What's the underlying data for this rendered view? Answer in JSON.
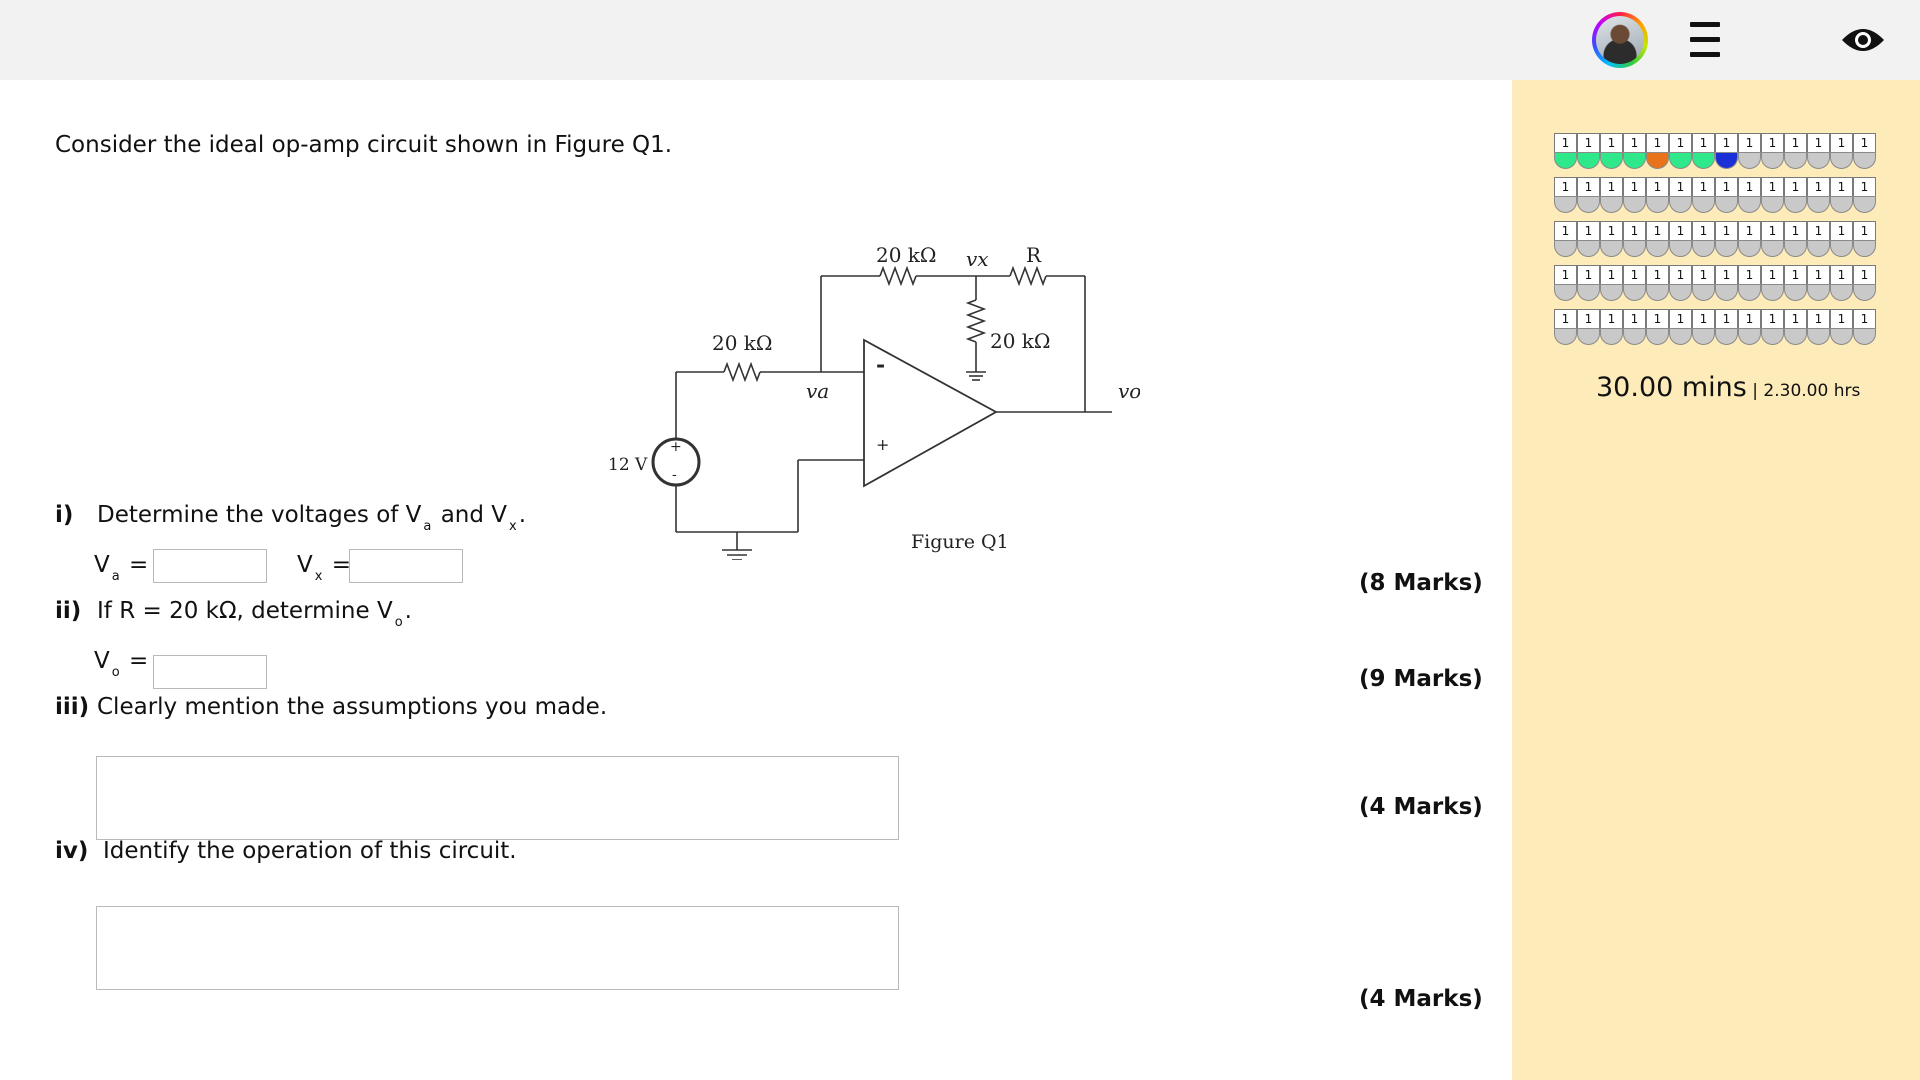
{
  "header": {
    "avatar_icon": "user-avatar",
    "menu_icon": "hamburger-menu-icon",
    "eye_icon": "eye-icon"
  },
  "question": {
    "intro": "Consider the ideal op-amp circuit shown in Figure Q1.",
    "figure": {
      "caption": "Figure Q1",
      "labels": {
        "r1": "20 kΩ",
        "r2": "20 kΩ",
        "r3": "20 kΩ",
        "r": "R",
        "vx": "vx",
        "va": "va",
        "vo": "vo",
        "source": "12 V",
        "minus": "-",
        "plus": "+"
      }
    },
    "parts": [
      {
        "label": "i)",
        "text_pre": "Determine the voltages of V",
        "sub1": "a",
        "text_mid": " and V",
        "sub2": "x",
        "text_post": ".",
        "marks": "(8 Marks)"
      },
      {
        "label": "ii)",
        "text_pre": "If R = 20 kΩ, determine V",
        "sub1": "o",
        "text_post": ".",
        "marks": "(9 Marks)"
      },
      {
        "label": "iii)",
        "text": "Clearly mention the assumptions you made.",
        "marks": "(4 Marks)"
      },
      {
        "label": "iv)",
        "text": "Identify the operation of this circuit.",
        "marks": "(4 Marks)"
      }
    ],
    "inputs": {
      "va_label": "V",
      "va_sub": "a",
      "va_eq": " =",
      "vx_label": "V",
      "vx_sub": "x",
      "vx_eq": " =",
      "vo_label": "V",
      "vo_sub": "o",
      "vo_eq": " =",
      "va_value": "",
      "vx_value": "",
      "vo_value": "",
      "assumptions_value": "",
      "operation_value": ""
    }
  },
  "sidebar": {
    "question_grid": {
      "cell_label": "1",
      "rows": [
        [
          "#2ee88a",
          "#2ee88a",
          "#2ee88a",
          "#2ee88a",
          "#e8731a",
          "#2ee88a",
          "#2ee88a",
          "#1a2fd6",
          "#c9c9c9",
          "#c9c9c9",
          "#c9c9c9",
          "#c9c9c9",
          "#c9c9c9",
          "#c9c9c9"
        ],
        [
          "#c9c9c9",
          "#c9c9c9",
          "#c9c9c9",
          "#c9c9c9",
          "#c9c9c9",
          "#c9c9c9",
          "#c9c9c9",
          "#c9c9c9",
          "#c9c9c9",
          "#c9c9c9",
          "#c9c9c9",
          "#c9c9c9",
          "#c9c9c9",
          "#c9c9c9"
        ],
        [
          "#c9c9c9",
          "#c9c9c9",
          "#c9c9c9",
          "#c9c9c9",
          "#c9c9c9",
          "#c9c9c9",
          "#c9c9c9",
          "#c9c9c9",
          "#c9c9c9",
          "#c9c9c9",
          "#c9c9c9",
          "#c9c9c9",
          "#c9c9c9",
          "#c9c9c9"
        ],
        [
          "#c9c9c9",
          "#c9c9c9",
          "#c9c9c9",
          "#c9c9c9",
          "#c9c9c9",
          "#c9c9c9",
          "#c9c9c9",
          "#c9c9c9",
          "#c9c9c9",
          "#c9c9c9",
          "#c9c9c9",
          "#c9c9c9",
          "#c9c9c9",
          "#c9c9c9"
        ],
        [
          "#c9c9c9",
          "#c9c9c9",
          "#c9c9c9",
          "#c9c9c9",
          "#c9c9c9",
          "#c9c9c9",
          "#c9c9c9",
          "#c9c9c9",
          "#c9c9c9",
          "#c9c9c9",
          "#c9c9c9",
          "#c9c9c9",
          "#c9c9c9",
          "#c9c9c9"
        ]
      ]
    },
    "timer": {
      "question_time": "30.00 mins",
      "separator": " | ",
      "total_time": "2.30.00 hrs"
    }
  },
  "colors": {
    "sidebar_bg": "#fdebb9",
    "header_bg": "#f2f2f2",
    "answered": "#2ee88a",
    "flagged": "#e8731a",
    "current": "#1a2fd6",
    "unanswered": "#c9c9c9"
  }
}
